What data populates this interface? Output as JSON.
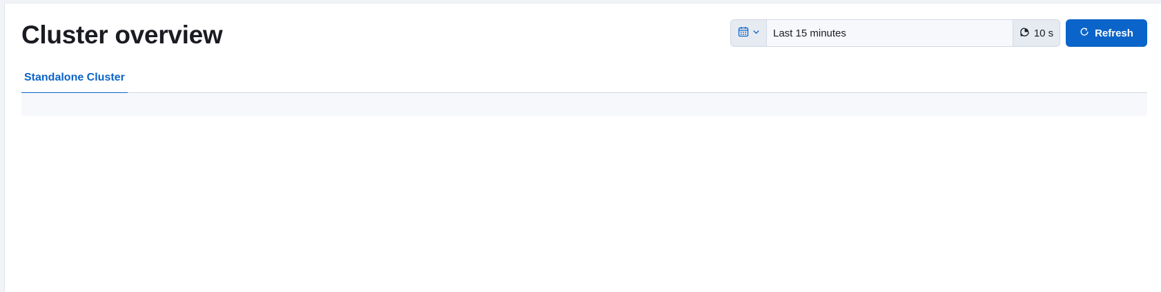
{
  "page": {
    "title": "Cluster overview"
  },
  "time_picker": {
    "quick_menu_icon": "calendar-icon",
    "quick_menu_chevron": "chevron-down-icon",
    "range_label": "Last 15 minutes",
    "interval_icon": "auto-refresh-icon",
    "interval_label": "10 s"
  },
  "refresh_button": {
    "icon": "refresh-icon",
    "label": "Refresh"
  },
  "tabs": [
    {
      "label": "Standalone Cluster",
      "selected": true
    }
  ],
  "colors": {
    "accent": "#0b64c9",
    "title_text": "#1a1c21",
    "control_background": "#e6ebf2"
  }
}
